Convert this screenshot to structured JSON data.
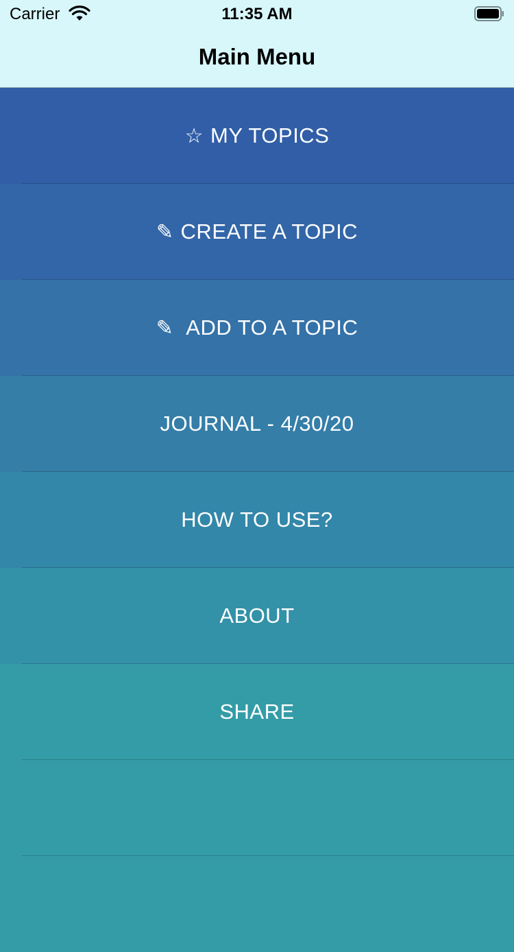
{
  "status_bar": {
    "carrier": "Carrier",
    "time": "11:35 AM",
    "wifi_icon": "wifi-icon",
    "battery_icon": "battery-icon"
  },
  "nav": {
    "title": "Main Menu"
  },
  "menu": {
    "items": [
      {
        "label": "MY TOPICS",
        "glyph": "☆",
        "icon": "star-icon",
        "color": "#315ea7"
      },
      {
        "label": "CREATE A TOPIC",
        "glyph": "✎",
        "icon": "pencil-icon",
        "color": "#3366a8"
      },
      {
        "label": "ADD TO A TOPIC",
        "glyph": "✎",
        "icon": "pencil-icon",
        "color": "#3472a8"
      },
      {
        "label": "JOURNAL - 4/30/20",
        "glyph": "",
        "icon": "",
        "color": "#347ea8"
      },
      {
        "label": "HOW TO USE?",
        "glyph": "",
        "icon": "",
        "color": "#3387a9"
      },
      {
        "label": "ABOUT",
        "glyph": "",
        "icon": "",
        "color": "#3391a8"
      },
      {
        "label": "SHARE",
        "glyph": "",
        "icon": "",
        "color": "#349ca7"
      },
      {
        "label": "",
        "glyph": "",
        "icon": "",
        "color": "#349ca7"
      },
      {
        "label": "",
        "glyph": "",
        "icon": "",
        "color": "#349ca7"
      }
    ]
  }
}
